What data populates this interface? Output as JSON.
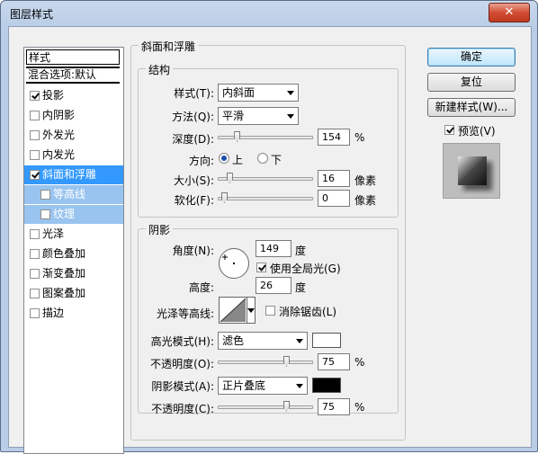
{
  "window": {
    "title": "图层样式",
    "close_symbol": "✕"
  },
  "style_list": {
    "header": "样式",
    "blend_options": "混合选项:默认",
    "items": [
      {
        "label": "投影",
        "checked": true
      },
      {
        "label": "内阴影",
        "checked": false
      },
      {
        "label": "外发光",
        "checked": false
      },
      {
        "label": "内发光",
        "checked": false
      },
      {
        "label": "斜面和浮雕",
        "checked": true,
        "selected": true
      },
      {
        "label": "等高线",
        "checked": false,
        "sub": true
      },
      {
        "label": "纹理",
        "checked": false,
        "sub": true
      },
      {
        "label": "光泽",
        "checked": false
      },
      {
        "label": "颜色叠加",
        "checked": false
      },
      {
        "label": "渐变叠加",
        "checked": false
      },
      {
        "label": "图案叠加",
        "checked": false
      },
      {
        "label": "描边",
        "checked": false
      }
    ]
  },
  "bevel": {
    "group_title": "斜面和浮雕",
    "structure": {
      "title": "结构",
      "style_label": "样式(T):",
      "style_value": "内斜面",
      "method_label": "方法(Q):",
      "method_value": "平滑",
      "depth_label": "深度(D):",
      "depth_value": "154",
      "depth_unit": "%",
      "depth_slider": 0.154,
      "direction_label": "方向:",
      "direction_up": "上",
      "direction_down": "下",
      "direction_selected": "上",
      "size_label": "大小(S):",
      "size_value": "16",
      "size_unit": "像素",
      "size_slider": 0.064,
      "soften_label": "软化(F):",
      "soften_value": "0",
      "soften_unit": "像素",
      "soften_slider": 0
    },
    "shading": {
      "title": "阴影",
      "angle_label": "角度(N):",
      "angle_value": "149",
      "angle_unit": "度",
      "global_light_label": "使用全局光(G)",
      "global_light_checked": true,
      "altitude_label": "高度:",
      "altitude_value": "26",
      "altitude_unit": "度",
      "gloss_contour_label": "光泽等高线:",
      "anti_alias_label": "消除锯齿(L)",
      "anti_alias_checked": false,
      "highlight_mode_label": "高光模式(H):",
      "highlight_mode_value": "滤色",
      "highlight_color": "#ffffff",
      "highlight_opacity_label": "不透明度(O):",
      "highlight_opacity_value": "75",
      "highlight_opacity_unit": "%",
      "highlight_opacity_slider": 0.75,
      "shadow_mode_label": "阴影模式(A):",
      "shadow_mode_value": "正片叠底",
      "shadow_color": "#000000",
      "shadow_opacity_label": "不透明度(C):",
      "shadow_opacity_value": "75",
      "shadow_opacity_unit": "%",
      "shadow_opacity_slider": 0.75
    }
  },
  "buttons": {
    "ok": "确定",
    "reset": "复位",
    "new_style": "新建样式(W)...",
    "preview_label": "预览(V)",
    "preview_checked": true
  },
  "colors": {
    "selection": "#3399ff",
    "sub_selection": "#99c4ef"
  }
}
